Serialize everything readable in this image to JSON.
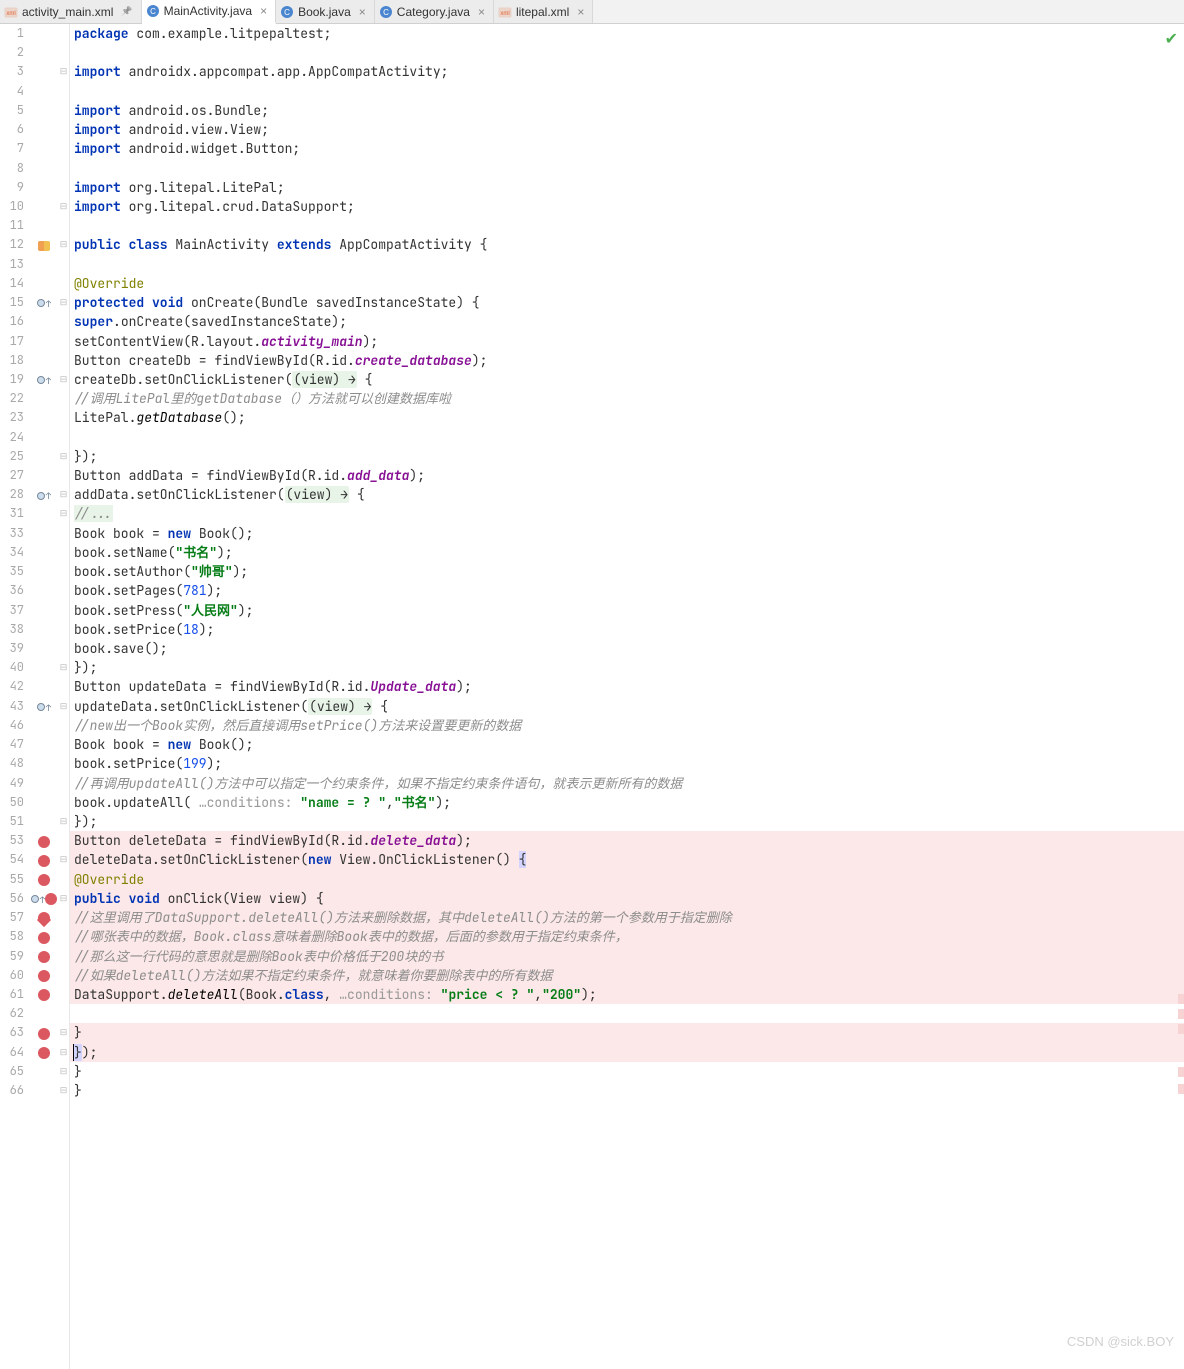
{
  "tabs": [
    {
      "label": "activity_main.xml",
      "icon": "xml",
      "active": false,
      "pin": true
    },
    {
      "label": "MainActivity.java",
      "icon": "java-class",
      "active": true,
      "close": true
    },
    {
      "label": "Book.java",
      "icon": "java-class",
      "active": false,
      "close": true
    },
    {
      "label": "Category.java",
      "icon": "java-class",
      "active": false,
      "close": true
    },
    {
      "label": "litepal.xml",
      "icon": "xml",
      "active": false,
      "close": true
    }
  ],
  "watermark": "CSDN @sick.BOY",
  "status_icon": "check",
  "code_lines": [
    {
      "n": 1,
      "t": [
        [
          "kw",
          "package"
        ],
        [
          "",
          " com.example.litpepaltest;"
        ]
      ]
    },
    {
      "n": 2,
      "t": [
        [
          "",
          ""
        ]
      ]
    },
    {
      "n": 3,
      "fold": "-",
      "t": [
        [
          "kw",
          "import"
        ],
        [
          "",
          " androidx.appcompat.app.AppCompatActivity;"
        ]
      ]
    },
    {
      "n": 4,
      "t": [
        [
          "",
          ""
        ]
      ]
    },
    {
      "n": 5,
      "t": [
        [
          "kw",
          "import"
        ],
        [
          "",
          " android.os.Bundle;"
        ]
      ]
    },
    {
      "n": 6,
      "t": [
        [
          "kw",
          "import"
        ],
        [
          "",
          " android.view.View;"
        ]
      ]
    },
    {
      "n": 7,
      "t": [
        [
          "kw",
          "import"
        ],
        [
          "",
          " android.widget.Button;"
        ]
      ]
    },
    {
      "n": 8,
      "t": [
        [
          "",
          ""
        ]
      ]
    },
    {
      "n": 9,
      "t": [
        [
          "kw",
          "import"
        ],
        [
          "",
          " org.litepal.LitePal;"
        ]
      ]
    },
    {
      "n": 10,
      "fold": "-",
      "t": [
        [
          "kw",
          "import"
        ],
        [
          "",
          " org.litepal.crud.DataSupport;"
        ]
      ]
    },
    {
      "n": 11,
      "t": [
        [
          "",
          ""
        ]
      ]
    },
    {
      "n": 12,
      "gi": "run",
      "fold": "-",
      "t": [
        [
          "kw",
          "public class"
        ],
        [
          "",
          " MainActivity "
        ],
        [
          "kw",
          "extends"
        ],
        [
          "",
          " AppCompatActivity {"
        ]
      ]
    },
    {
      "n": 13,
      "t": [
        [
          "",
          ""
        ]
      ]
    },
    {
      "n": 14,
      "t": [
        [
          "",
          "    "
        ],
        [
          "ann",
          "@Override"
        ]
      ]
    },
    {
      "n": 15,
      "gi": "ovr",
      "fold": "-",
      "t": [
        [
          "",
          "    "
        ],
        [
          "kw",
          "protected void"
        ],
        [
          "",
          " onCreate(Bundle savedInstanceState) {"
        ]
      ]
    },
    {
      "n": 16,
      "t": [
        [
          "",
          "        "
        ],
        [
          "kw",
          "super"
        ],
        [
          "",
          ".onCreate(savedInstanceState);"
        ]
      ]
    },
    {
      "n": 17,
      "t": [
        [
          "",
          "        setContentView(R.layout."
        ],
        [
          "fld2",
          "activity_main"
        ],
        [
          "",
          ");"
        ]
      ]
    },
    {
      "n": 18,
      "t": [
        [
          "",
          "        Button createDb = findViewById(R.id."
        ],
        [
          "fld2",
          "create_database"
        ],
        [
          "",
          ");"
        ]
      ]
    },
    {
      "n": 19,
      "gi": "ovr",
      "fold": "-",
      "t": [
        [
          "",
          "        createDb.setOnClickListener("
        ],
        [
          "lambda",
          "(view) →"
        ],
        [
          "",
          " {"
        ]
      ]
    },
    {
      "n": 22,
      "t": [
        [
          "",
          "                "
        ],
        [
          "cmt",
          "//调用LitePal里的getDatabase（）方法就可以创建数据库啦"
        ]
      ]
    },
    {
      "n": 23,
      "t": [
        [
          "",
          "                LitePal."
        ],
        [
          "mth",
          "getDatabase"
        ],
        [
          "",
          "();"
        ]
      ]
    },
    {
      "n": 24,
      "t": [
        [
          "",
          ""
        ]
      ]
    },
    {
      "n": 25,
      "fold": "-",
      "t": [
        [
          "",
          "        });"
        ]
      ]
    },
    {
      "n": 27,
      "t": [
        [
          "",
          "        Button addData = findViewById(R.id."
        ],
        [
          "fld2",
          "add_data"
        ],
        [
          "",
          ");"
        ]
      ]
    },
    {
      "n": 28,
      "gi": "ovr",
      "fold": "-",
      "t": [
        [
          "",
          "        addData.setOnClickListener("
        ],
        [
          "lambda",
          "(view) →"
        ],
        [
          "",
          " {"
        ]
      ]
    },
    {
      "n": 31,
      "fold": "-",
      "t": [
        [
          "",
          "                "
        ],
        [
          "cmt-hl",
          "//..."
        ]
      ]
    },
    {
      "n": 33,
      "t": [
        [
          "",
          "                Book book = "
        ],
        [
          "kw",
          "new"
        ],
        [
          "",
          " Book();"
        ]
      ]
    },
    {
      "n": 34,
      "t": [
        [
          "",
          "                book.setName("
        ],
        [
          "str",
          "\"书名\""
        ],
        [
          "",
          ");"
        ]
      ]
    },
    {
      "n": 35,
      "t": [
        [
          "",
          "                book.setAuthor("
        ],
        [
          "str",
          "\"帅哥\""
        ],
        [
          "",
          ");"
        ]
      ]
    },
    {
      "n": 36,
      "t": [
        [
          "",
          "                book.setPages("
        ],
        [
          "num",
          "781"
        ],
        [
          "",
          ");"
        ]
      ]
    },
    {
      "n": 37,
      "t": [
        [
          "",
          "                book.setPress("
        ],
        [
          "str",
          "\"人民网\""
        ],
        [
          "",
          ");"
        ]
      ]
    },
    {
      "n": 38,
      "t": [
        [
          "",
          "                book.setPrice("
        ],
        [
          "num",
          "18"
        ],
        [
          "",
          ");"
        ]
      ]
    },
    {
      "n": 39,
      "t": [
        [
          "",
          "                book.save();"
        ]
      ]
    },
    {
      "n": 40,
      "fold": "-",
      "t": [
        [
          "",
          "        });"
        ]
      ]
    },
    {
      "n": 42,
      "t": [
        [
          "",
          "        Button updateData = findViewById(R.id."
        ],
        [
          "fld2",
          "Update_data"
        ],
        [
          "",
          ");"
        ]
      ]
    },
    {
      "n": 43,
      "gi": "ovr",
      "fold": "-",
      "t": [
        [
          "",
          "        updateData.setOnClickListener("
        ],
        [
          "lambda",
          "(view) →"
        ],
        [
          "",
          " {"
        ]
      ]
    },
    {
      "n": 46,
      "t": [
        [
          "",
          "                "
        ],
        [
          "cmt",
          "//new出一个Book实例，然后直接调用setPrice()方法来设置要更新的数据"
        ]
      ]
    },
    {
      "n": 47,
      "t": [
        [
          "",
          "                Book book = "
        ],
        [
          "kw",
          "new"
        ],
        [
          "",
          " Book();"
        ]
      ]
    },
    {
      "n": 48,
      "t": [
        [
          "",
          "                book.setPrice("
        ],
        [
          "num",
          "199"
        ],
        [
          "",
          ");"
        ]
      ]
    },
    {
      "n": 49,
      "t": [
        [
          "",
          "                "
        ],
        [
          "cmt",
          "//再调用updateAll()方法中可以指定一个约束条件，如果不指定约束条件语句，就表示更新所有的数据"
        ]
      ]
    },
    {
      "n": 50,
      "t": [
        [
          "",
          "                book.updateAll( "
        ],
        [
          "hint",
          "…conditions: "
        ],
        [
          "str",
          "\"name = ? \""
        ],
        [
          "",
          ","
        ],
        [
          "str",
          "\"书名\""
        ],
        [
          "",
          ");"
        ]
      ]
    },
    {
      "n": 51,
      "fold": "-",
      "t": [
        [
          "",
          "        });"
        ]
      ]
    },
    {
      "n": 53,
      "bp": true,
      "hl": true,
      "t": [
        [
          "",
          "        Button deleteData = findViewById(R.id."
        ],
        [
          "fld2",
          "delete_data"
        ],
        [
          "",
          ");"
        ]
      ]
    },
    {
      "n": 54,
      "bp": true,
      "hl": true,
      "fold": "-",
      "t": [
        [
          "",
          "        deleteData.setOnClickListener("
        ],
        [
          "kw",
          "new"
        ],
        [
          "",
          " View.OnClickListener() "
        ],
        [
          "caret",
          "{"
        ]
      ]
    },
    {
      "n": 55,
      "bp": true,
      "hl": true,
      "t": [
        [
          "",
          "            "
        ],
        [
          "ann",
          "@Override"
        ]
      ]
    },
    {
      "n": 56,
      "bp": true,
      "bpd": true,
      "gi": "ovr",
      "hl": true,
      "fold": "-",
      "t": [
        [
          "",
          "            "
        ],
        [
          "kw",
          "public void"
        ],
        [
          "",
          " onClick(View view) {"
        ]
      ]
    },
    {
      "n": 57,
      "bp": true,
      "hl": true,
      "t": [
        [
          "",
          "                "
        ],
        [
          "cmt",
          "//这里调用了DataSupport.deleteAll()方法来删除数据，其中deleteAll()方法的第一个参数用于指定删除"
        ]
      ]
    },
    {
      "n": 58,
      "bp": true,
      "hl": true,
      "t": [
        [
          "",
          "                "
        ],
        [
          "cmt",
          "//哪张表中的数据，Book.class意味着删除Book表中的数据，后面的参数用于指定约束条件，"
        ]
      ]
    },
    {
      "n": 59,
      "bp": true,
      "hl": true,
      "t": [
        [
          "",
          "                "
        ],
        [
          "cmt",
          "//那么这一行代码的意思就是删除Book表中价格低于200块的书"
        ]
      ]
    },
    {
      "n": 60,
      "bp": true,
      "hl": true,
      "t": [
        [
          "",
          "                "
        ],
        [
          "cmt",
          "//如果deleteAll()方法如果不指定约束条件，就意味着你要删除表中的所有数据"
        ]
      ]
    },
    {
      "n": 61,
      "bp": true,
      "hl": true,
      "t": [
        [
          "",
          "                DataSupport."
        ],
        [
          "mth",
          "deleteAll"
        ],
        [
          "",
          "(Book."
        ],
        [
          "kw",
          "class"
        ],
        [
          "",
          ", "
        ],
        [
          "hint",
          "…conditions: "
        ],
        [
          "str",
          "\"price < ? \""
        ],
        [
          "",
          ","
        ],
        [
          "str",
          "\"200\""
        ],
        [
          "",
          ");"
        ]
      ]
    },
    {
      "n": 62,
      "hl": false,
      "t": [
        [
          "",
          ""
        ]
      ]
    },
    {
      "n": 63,
      "bp": true,
      "hl": true,
      "fold": "-",
      "t": [
        [
          "",
          "            }"
        ]
      ]
    },
    {
      "n": 64,
      "bp": true,
      "hl": true,
      "fold": "-",
      "t": [
        [
          "",
          "        "
        ],
        [
          "caret",
          "}"
        ],
        [
          "",
          ");"
        ]
      ],
      "cursor": true
    },
    {
      "n": 65,
      "fold": "-",
      "t": [
        [
          "",
          "    }"
        ]
      ]
    },
    {
      "n": 66,
      "fold": "-",
      "t": [
        [
          "",
          "}"
        ]
      ]
    }
  ]
}
